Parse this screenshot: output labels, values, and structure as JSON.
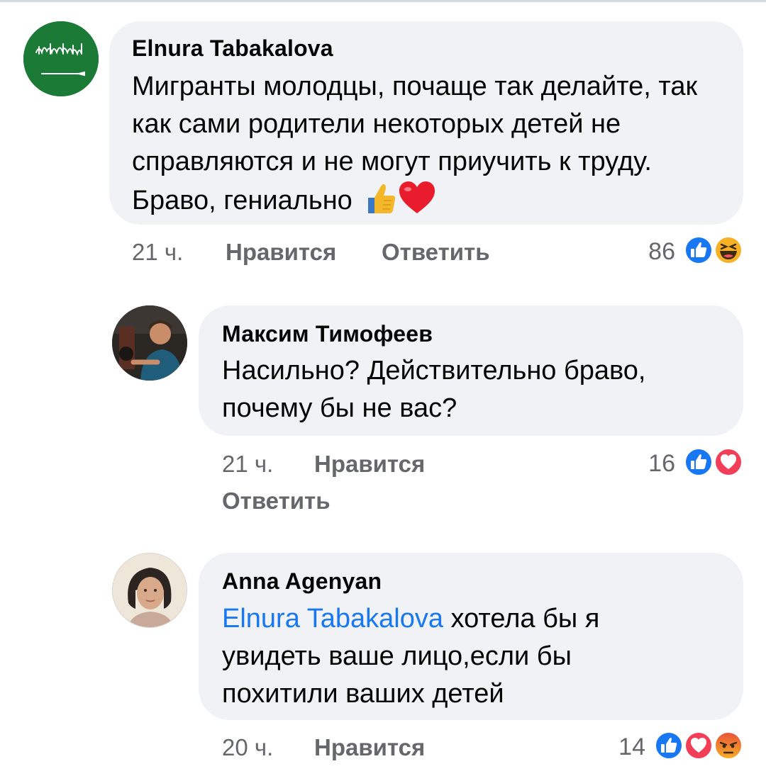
{
  "comments": [
    {
      "author": "Elnura Tabakalova",
      "text": "Мигранты молодцы, почаще так делайте, так как сами родители некоторых детей не справляются и не могут приучить к труду. Браво, гениально",
      "time": "21 ч.",
      "like_label": "Нравится",
      "reply_label": "Ответить",
      "reaction_count": "86",
      "reactions": [
        "like-icon",
        "haha-icon"
      ],
      "inline_emoji": [
        "thumbs-up-emoji",
        "heart-emoji"
      ]
    },
    {
      "author": "Максим Тимофеев",
      "text": "Насильно? Действительно браво, почему бы не вас?",
      "time": "21 ч.",
      "like_label": "Нравится",
      "reply_label": "Ответить",
      "reaction_count": "16",
      "reactions": [
        "like-icon",
        "love-icon"
      ]
    },
    {
      "author": "Anna Agenyan",
      "mention": "Elnura Tabakalova",
      "text": "хотела бы я увидеть ваше лицо,если бы похитили ваших детей",
      "time": "20 ч.",
      "like_label": "Нравится",
      "reaction_count": "14",
      "reactions": [
        "like-icon",
        "love-icon",
        "angry-icon"
      ]
    }
  ],
  "colors": {
    "bubble": "#f0f2f5",
    "meta_text": "#65676b",
    "mention": "#1877f2",
    "like": "#1877f2",
    "love": "#f33e58",
    "haha": "#f7b125",
    "avatar_flag": "#1a7a36"
  }
}
